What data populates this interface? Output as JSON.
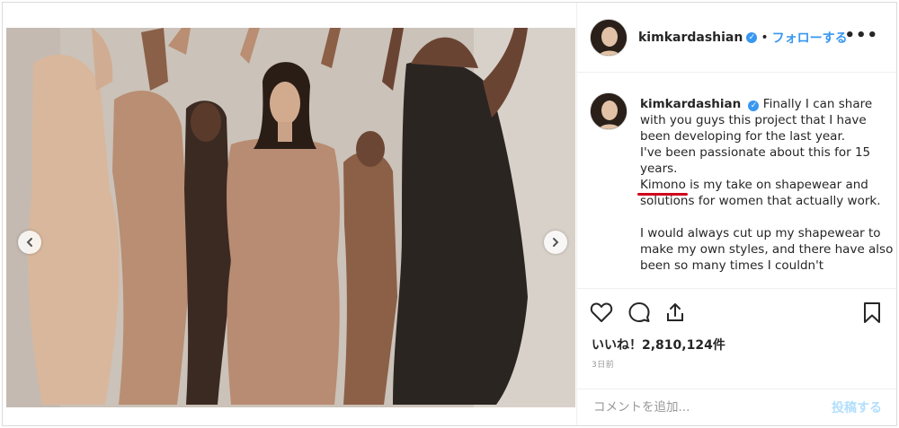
{
  "post": {
    "username": "kimkardashian",
    "verified_mark": "✓",
    "separator": "•",
    "follow_label": "フォローする",
    "more_label": "•••",
    "caption": {
      "username": "kimkardashian",
      "line1": "Finally I can share with you guys this project that I have been developing for the last year.",
      "line2": "I've been passionate about this for 15 years.",
      "brand": "Kimono",
      "line3": " is my take on shapewear and solutions for women that actually work.",
      "line4": "I would always cut up my shapewear to make my own styles, and there have also been so many times I couldn't"
    },
    "likes_label": "いいね！2,810,124件",
    "time_label": "3日前",
    "comment_placeholder": "コメントを追加...",
    "post_button_label": "投稿する"
  },
  "carousel": {
    "slide_count": 4,
    "active_index": 1
  },
  "colors": {
    "accent": "#3897f0",
    "underline": "#d0021b",
    "disabled_post": "#b2dffc"
  },
  "icons": [
    "chevron-left-icon",
    "chevron-right-icon",
    "heart-icon",
    "comment-icon",
    "share-icon",
    "bookmark-icon",
    "verified-badge-icon",
    "more-options-icon"
  ]
}
